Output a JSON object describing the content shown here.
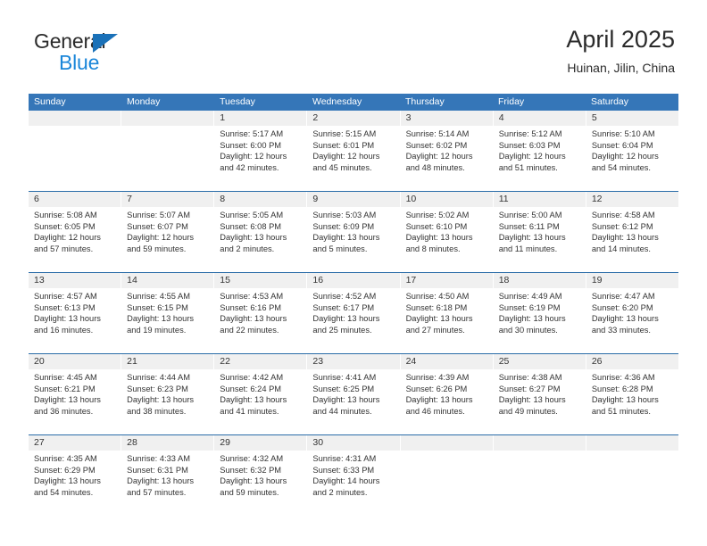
{
  "brand": {
    "line1": "General",
    "line2": "Blue",
    "triangle_color": "#1a71b8",
    "blue_color": "#1a86d9",
    "general_color": "#2b2b2b"
  },
  "header": {
    "title": "April 2025",
    "subtitle": "Huinan, Jilin, China"
  },
  "theme": {
    "header_blue": "#3576b8",
    "row_rule_blue": "#2a6ca8",
    "day_band_gray": "#f0f0f0",
    "text_color": "#333333"
  },
  "weekdays": [
    "Sunday",
    "Monday",
    "Tuesday",
    "Wednesday",
    "Thursday",
    "Friday",
    "Saturday"
  ],
  "weeks": [
    [
      {
        "day": "",
        "sunrise": "",
        "sunset": "",
        "daylight": ""
      },
      {
        "day": "",
        "sunrise": "",
        "sunset": "",
        "daylight": ""
      },
      {
        "day": "1",
        "sunrise": "Sunrise: 5:17 AM",
        "sunset": "Sunset: 6:00 PM",
        "daylight": "Daylight: 12 hours and 42 minutes."
      },
      {
        "day": "2",
        "sunrise": "Sunrise: 5:15 AM",
        "sunset": "Sunset: 6:01 PM",
        "daylight": "Daylight: 12 hours and 45 minutes."
      },
      {
        "day": "3",
        "sunrise": "Sunrise: 5:14 AM",
        "sunset": "Sunset: 6:02 PM",
        "daylight": "Daylight: 12 hours and 48 minutes."
      },
      {
        "day": "4",
        "sunrise": "Sunrise: 5:12 AM",
        "sunset": "Sunset: 6:03 PM",
        "daylight": "Daylight: 12 hours and 51 minutes."
      },
      {
        "day": "5",
        "sunrise": "Sunrise: 5:10 AM",
        "sunset": "Sunset: 6:04 PM",
        "daylight": "Daylight: 12 hours and 54 minutes."
      }
    ],
    [
      {
        "day": "6",
        "sunrise": "Sunrise: 5:08 AM",
        "sunset": "Sunset: 6:05 PM",
        "daylight": "Daylight: 12 hours and 57 minutes."
      },
      {
        "day": "7",
        "sunrise": "Sunrise: 5:07 AM",
        "sunset": "Sunset: 6:07 PM",
        "daylight": "Daylight: 12 hours and 59 minutes."
      },
      {
        "day": "8",
        "sunrise": "Sunrise: 5:05 AM",
        "sunset": "Sunset: 6:08 PM",
        "daylight": "Daylight: 13 hours and 2 minutes."
      },
      {
        "day": "9",
        "sunrise": "Sunrise: 5:03 AM",
        "sunset": "Sunset: 6:09 PM",
        "daylight": "Daylight: 13 hours and 5 minutes."
      },
      {
        "day": "10",
        "sunrise": "Sunrise: 5:02 AM",
        "sunset": "Sunset: 6:10 PM",
        "daylight": "Daylight: 13 hours and 8 minutes."
      },
      {
        "day": "11",
        "sunrise": "Sunrise: 5:00 AM",
        "sunset": "Sunset: 6:11 PM",
        "daylight": "Daylight: 13 hours and 11 minutes."
      },
      {
        "day": "12",
        "sunrise": "Sunrise: 4:58 AM",
        "sunset": "Sunset: 6:12 PM",
        "daylight": "Daylight: 13 hours and 14 minutes."
      }
    ],
    [
      {
        "day": "13",
        "sunrise": "Sunrise: 4:57 AM",
        "sunset": "Sunset: 6:13 PM",
        "daylight": "Daylight: 13 hours and 16 minutes."
      },
      {
        "day": "14",
        "sunrise": "Sunrise: 4:55 AM",
        "sunset": "Sunset: 6:15 PM",
        "daylight": "Daylight: 13 hours and 19 minutes."
      },
      {
        "day": "15",
        "sunrise": "Sunrise: 4:53 AM",
        "sunset": "Sunset: 6:16 PM",
        "daylight": "Daylight: 13 hours and 22 minutes."
      },
      {
        "day": "16",
        "sunrise": "Sunrise: 4:52 AM",
        "sunset": "Sunset: 6:17 PM",
        "daylight": "Daylight: 13 hours and 25 minutes."
      },
      {
        "day": "17",
        "sunrise": "Sunrise: 4:50 AM",
        "sunset": "Sunset: 6:18 PM",
        "daylight": "Daylight: 13 hours and 27 minutes."
      },
      {
        "day": "18",
        "sunrise": "Sunrise: 4:49 AM",
        "sunset": "Sunset: 6:19 PM",
        "daylight": "Daylight: 13 hours and 30 minutes."
      },
      {
        "day": "19",
        "sunrise": "Sunrise: 4:47 AM",
        "sunset": "Sunset: 6:20 PM",
        "daylight": "Daylight: 13 hours and 33 minutes."
      }
    ],
    [
      {
        "day": "20",
        "sunrise": "Sunrise: 4:45 AM",
        "sunset": "Sunset: 6:21 PM",
        "daylight": "Daylight: 13 hours and 36 minutes."
      },
      {
        "day": "21",
        "sunrise": "Sunrise: 4:44 AM",
        "sunset": "Sunset: 6:23 PM",
        "daylight": "Daylight: 13 hours and 38 minutes."
      },
      {
        "day": "22",
        "sunrise": "Sunrise: 4:42 AM",
        "sunset": "Sunset: 6:24 PM",
        "daylight": "Daylight: 13 hours and 41 minutes."
      },
      {
        "day": "23",
        "sunrise": "Sunrise: 4:41 AM",
        "sunset": "Sunset: 6:25 PM",
        "daylight": "Daylight: 13 hours and 44 minutes."
      },
      {
        "day": "24",
        "sunrise": "Sunrise: 4:39 AM",
        "sunset": "Sunset: 6:26 PM",
        "daylight": "Daylight: 13 hours and 46 minutes."
      },
      {
        "day": "25",
        "sunrise": "Sunrise: 4:38 AM",
        "sunset": "Sunset: 6:27 PM",
        "daylight": "Daylight: 13 hours and 49 minutes."
      },
      {
        "day": "26",
        "sunrise": "Sunrise: 4:36 AM",
        "sunset": "Sunset: 6:28 PM",
        "daylight": "Daylight: 13 hours and 51 minutes."
      }
    ],
    [
      {
        "day": "27",
        "sunrise": "Sunrise: 4:35 AM",
        "sunset": "Sunset: 6:29 PM",
        "daylight": "Daylight: 13 hours and 54 minutes."
      },
      {
        "day": "28",
        "sunrise": "Sunrise: 4:33 AM",
        "sunset": "Sunset: 6:31 PM",
        "daylight": "Daylight: 13 hours and 57 minutes."
      },
      {
        "day": "29",
        "sunrise": "Sunrise: 4:32 AM",
        "sunset": "Sunset: 6:32 PM",
        "daylight": "Daylight: 13 hours and 59 minutes."
      },
      {
        "day": "30",
        "sunrise": "Sunrise: 4:31 AM",
        "sunset": "Sunset: 6:33 PM",
        "daylight": "Daylight: 14 hours and 2 minutes."
      },
      {
        "day": "",
        "sunrise": "",
        "sunset": "",
        "daylight": ""
      },
      {
        "day": "",
        "sunrise": "",
        "sunset": "",
        "daylight": ""
      },
      {
        "day": "",
        "sunrise": "",
        "sunset": "",
        "daylight": ""
      }
    ]
  ]
}
